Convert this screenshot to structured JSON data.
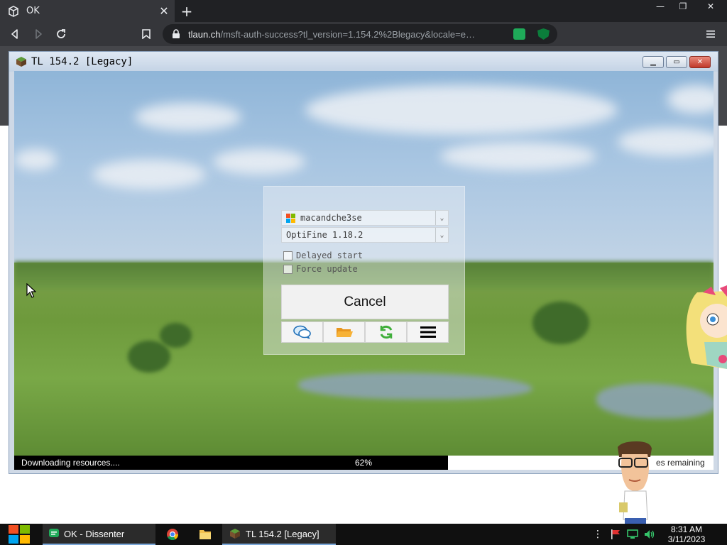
{
  "browser": {
    "tab_title": "OK",
    "url": "tlaun.ch/msft-auth-success?tl_version=1.154.2%2Blegacy&locale=e…",
    "url_host": "tlaun.ch",
    "url_path": "/msft-auth-success?tl_version=1.154.2%2Blegacy&locale=e…",
    "ublock_count": "1"
  },
  "launcher": {
    "window_title": "TL 154.2 [Legacy]",
    "account": "macandche3se",
    "version": "OptiFine 1.18.2",
    "delayed_start_label": "Delayed start",
    "force_update_label": "Force update",
    "cancel_label": "Cancel",
    "progress": {
      "status": "Downloading resources....",
      "percent_label": "62%",
      "percent": 62,
      "remaining": "es remaining"
    }
  },
  "taskbar": {
    "items": [
      {
        "label": "OK - Dissenter"
      },
      {
        "label": "TL 154.2 [Legacy]"
      }
    ],
    "time": "8:31 AM",
    "date": "3/11/2023"
  },
  "colors": {
    "progress_fill": "#000000",
    "accent": "#7aa7d9"
  }
}
